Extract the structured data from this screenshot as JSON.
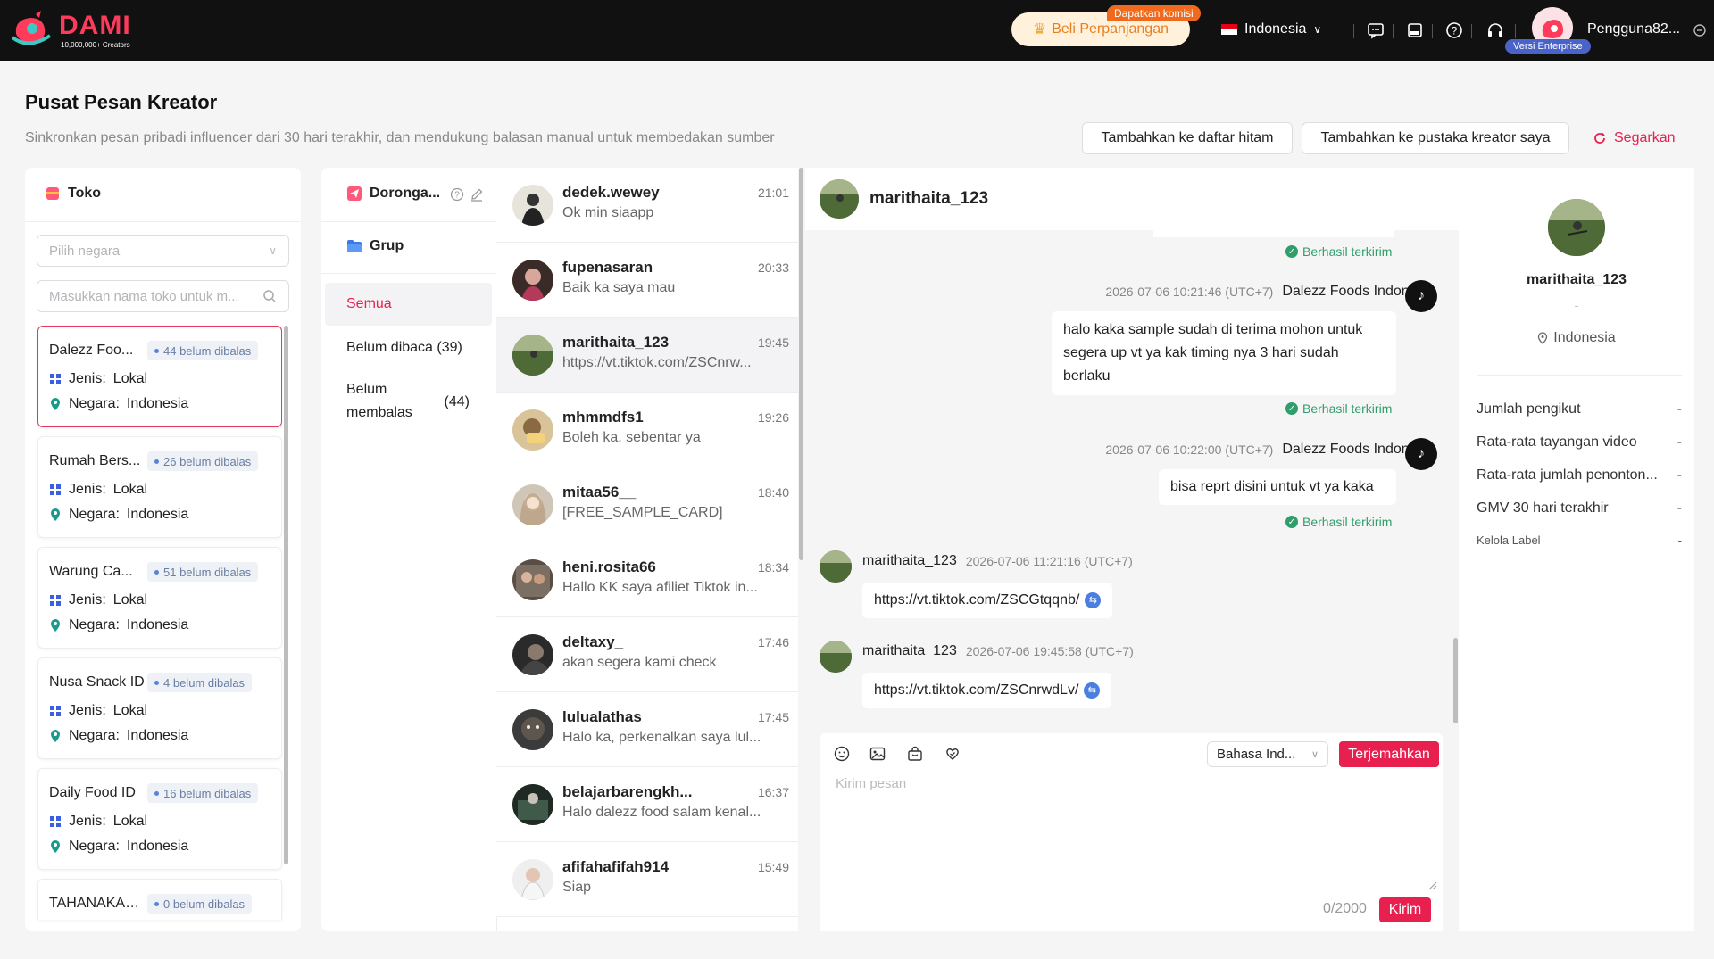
{
  "app": {
    "brand": "DAMI",
    "brand_sub": "10,000,000+ Creators",
    "commission_tag": "Dapatkan komisi",
    "renew_label": "Beli Perpanjangan",
    "country": "Indonesia",
    "user_name": "Pengguna82...",
    "enterprise_tag": "Versi Enterprise",
    "accent_color": "#e8204f"
  },
  "page": {
    "title": "Pusat Pesan Kreator",
    "subtitle": "Sinkronkan pesan pribadi influencer dari 30 hari terakhir, dan mendukung balasan manual untuk membedakan sumber",
    "blacklist_button": "Tambahkan ke daftar hitam",
    "library_button": "Tambahkan ke pustaka kreator saya",
    "refresh_button": "Segarkan"
  },
  "shops_panel": {
    "title": "Toko",
    "country_placeholder": "Pilih negara",
    "search_placeholder": "Masukkan nama toko untuk m...",
    "type_label": "Jenis:",
    "country_label": "Negara:",
    "shops": [
      {
        "name": "Dalezz Foo...",
        "unread": "44 belum dibalas",
        "type": "Lokal",
        "country": "Indonesia"
      },
      {
        "name": "Rumah Bers...",
        "unread": "26 belum dibalas",
        "type": "Lokal",
        "country": "Indonesia"
      },
      {
        "name": "Warung Ca...",
        "unread": "51 belum dibalas",
        "type": "Lokal",
        "country": "Indonesia"
      },
      {
        "name": "Nusa Snack ID",
        "unread": "4 belum dibalas",
        "type": "Lokal",
        "country": "Indonesia"
      },
      {
        "name": "Daily Food ID",
        "unread": "16 belum dibalas",
        "type": "Lokal",
        "country": "Indonesia"
      },
      {
        "name": "TAHANAKAN...",
        "unread": "0 belum dibalas"
      }
    ]
  },
  "filter_panel": {
    "push_label": "Doronga...",
    "group_label": "Grup",
    "filters": [
      "Semua",
      "Belum dibaca (39)"
    ],
    "unreplied_label_1": "Belum",
    "unreplied_label_2": "membalas",
    "unreplied_count": "(44)"
  },
  "conversations": [
    {
      "name": "dedek.wewey",
      "time": "21:01",
      "message": "Ok min siaapp"
    },
    {
      "name": "fupenasaran",
      "time": "20:33",
      "message": "Baik ka saya mau"
    },
    {
      "name": "marithaita_123",
      "time": "19:45",
      "message": "https://vt.tiktok.com/ZSCnrw..."
    },
    {
      "name": "mhmmdfs1",
      "time": "19:26",
      "message": "Boleh ka, sebentar ya"
    },
    {
      "name": "mitaa56__",
      "time": "18:40",
      "message": "[FREE_SAMPLE_CARD]"
    },
    {
      "name": "heni.rosita66",
      "time": "18:34",
      "message": "Hallo KK saya afiliet Tiktok in..."
    },
    {
      "name": "deltaxy_",
      "time": "17:46",
      "message": "akan segera kami check"
    },
    {
      "name": "lulualathas",
      "time": "17:45",
      "message": "Halo ka, perkenalkan saya lul..."
    },
    {
      "name": "belajarbarengkh...",
      "time": "16:37",
      "message": "Halo dalezz food salam kenal..."
    },
    {
      "name": "afifahafifah914",
      "time": "15:49",
      "message": "Siap"
    }
  ],
  "chat": {
    "contact": "marithaita_123",
    "sent_status": "Berhasil terkirim",
    "messages": [
      {
        "timestamp": "2026-07-06 10:21:46 (UTC+7)",
        "sender": "Dalezz Foods Indonesia",
        "line1": "halo kaka sample sudah di terima mohon untuk",
        "line2": "segera up vt ya kak timing nya 3 hari sudah",
        "line3": "berlaku"
      },
      {
        "timestamp": "2026-07-06 10:22:00 (UTC+7)",
        "sender": "Dalezz Foods Indonesia",
        "text": "bisa reprt disini untuk vt ya kaka"
      },
      {
        "sender": "marithaita_123",
        "timestamp": "2026-07-06 11:21:16 (UTC+7)",
        "text": "https://vt.tiktok.com/ZSCGtqqnb/"
      },
      {
        "sender": "marithaita_123",
        "timestamp": "2026-07-06 19:45:58 (UTC+7)",
        "text": "https://vt.tiktok.com/ZSCnrwdLv/"
      }
    ],
    "language": "Bahasa Ind...",
    "translate_button": "Terjemahkan",
    "input_placeholder": "Kirim pesan",
    "char_count": "0/2000",
    "send_button": "Kirim"
  },
  "profile": {
    "name": "marithaita_123",
    "dash": "-",
    "location": "Indonesia",
    "stats": [
      {
        "label": "Jumlah pengikut",
        "value": "-"
      },
      {
        "label": "Rata-rata tayangan video",
        "value": "-"
      },
      {
        "label": "Rata-rata jumlah penonton...",
        "value": "-"
      },
      {
        "label": "GMV 30 hari terakhir",
        "value": "-"
      }
    ],
    "label_manage": "Kelola Label",
    "label_value": "-"
  }
}
